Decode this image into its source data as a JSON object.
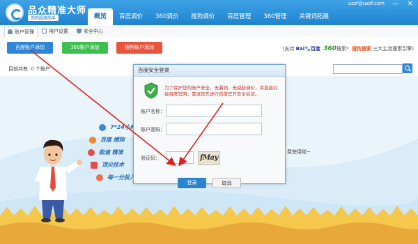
{
  "app": {
    "name": "品众精准大师",
    "slogan": "你的超级助手",
    "user": "uzzf@uzzf.com"
  },
  "nav_tabs": [
    "概览",
    "百度调价",
    "360调价",
    "搜狗调价",
    "百度管理",
    "360管理",
    "关键词拓展"
  ],
  "sub_tabs": [
    "账户管理",
    "用户设置",
    "安全中心"
  ],
  "actions": {
    "baidu_add": "百度账户添加",
    "qihoo_add": "360账户添加",
    "sogou_add": "搜狗账户添加"
  },
  "partners": {
    "support": "(支持",
    "baidu": "Bai🐾百度",
    "qihoo": "360",
    "qihoo_suffix": "搜索*",
    "sogou": "搜狗搜索",
    "tail": "三大主流搜索引擎)"
  },
  "account_count": {
    "prefix": "目前共有",
    "value": "0",
    "suffix": "个账户"
  },
  "features": [
    "7*24小时",
    "百度 搜狗",
    "极速 精准",
    "顶尖技术",
    "每一分投入"
  ],
  "after_text": "费使用啦~",
  "dialog": {
    "title": "百度安全登录",
    "notice": "为了保护您的账户安全，无漏洞、无威胁调价，将直接对接百度官网，需请您先进行百度官方安全验证。",
    "account_label": "账户名称：",
    "password_label": "账户密码：",
    "captcha_label": "验证码：",
    "captcha_text": "fMay",
    "login": "登录",
    "cancel": "取消"
  },
  "colors": {
    "title_bar": "#1e82cf",
    "baidu_button": "#2f86d6",
    "qihoo_button": "#3fbf4f",
    "sogou_button": "#e8553c",
    "annotation_arrow": "#e02020"
  }
}
